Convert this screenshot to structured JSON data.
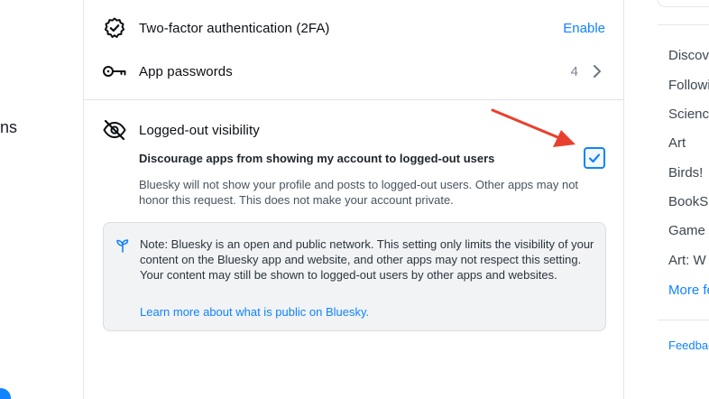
{
  "left_sidebar": {
    "fragment_text": "ns"
  },
  "settings": {
    "two_factor": {
      "label": "Two-factor authentication (2FA)",
      "action": "Enable"
    },
    "app_passwords": {
      "label": "App passwords",
      "count": "4"
    },
    "logged_out": {
      "title": "Logged-out visibility",
      "option_label": "Discourage apps from showing my account to logged-out users",
      "checked": true,
      "description": "Bluesky will not show your profile and posts to logged-out users. Other apps may not honor this request. This does not make your account private."
    },
    "note": {
      "text": "Note: Bluesky is an open and public network. This setting only limits the visibility of your content on the Bluesky app and website, and other apps may not respect this setting. Your content may still be shown to logged-out users by other apps and websites.",
      "link": "Learn more about what is public on Bluesky."
    }
  },
  "right_sidebar": {
    "feeds": [
      "Discover",
      "Following",
      "Science",
      "Art",
      "Birds!",
      "BookSky",
      "Game",
      "Art: W"
    ],
    "more_label": "More feeds",
    "feedback_label": "Feedback"
  },
  "colors": {
    "accent": "#1083fe",
    "arrow": "#e8402e"
  }
}
